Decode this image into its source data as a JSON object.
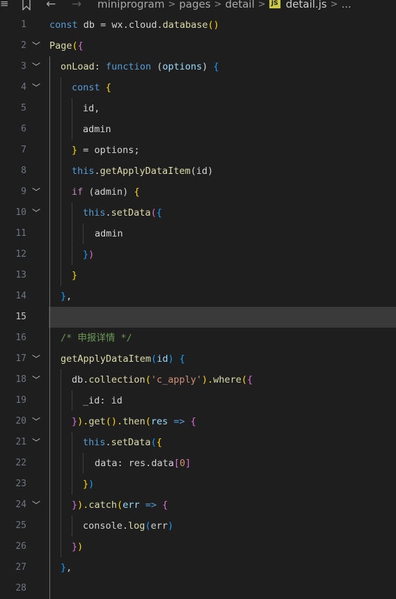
{
  "breadcrumb": {
    "hamburger": "≡",
    "segments": [
      "miniprogram",
      "pages",
      "detail"
    ],
    "file_badge": "JS",
    "file": "detail.js",
    "more": "..."
  },
  "editor": {
    "current_line": 15,
    "lines": [
      {
        "n": "1"
      },
      {
        "n": "2"
      },
      {
        "n": "3"
      },
      {
        "n": "4"
      },
      {
        "n": "5"
      },
      {
        "n": "6"
      },
      {
        "n": "7"
      },
      {
        "n": "8"
      },
      {
        "n": "9"
      },
      {
        "n": "10"
      },
      {
        "n": "11"
      },
      {
        "n": "12"
      },
      {
        "n": "13"
      },
      {
        "n": "14"
      },
      {
        "n": "15"
      },
      {
        "n": "16"
      },
      {
        "n": "17"
      },
      {
        "n": "18"
      },
      {
        "n": "19"
      },
      {
        "n": "20"
      },
      {
        "n": "21"
      },
      {
        "n": "22"
      },
      {
        "n": "23"
      },
      {
        "n": "24"
      },
      {
        "n": "25"
      },
      {
        "n": "26"
      },
      {
        "n": "27"
      },
      {
        "n": "28"
      }
    ],
    "code": {
      "l1": [
        "const",
        " db = ",
        "wx",
        ".",
        "cloud",
        ".",
        "database",
        "()"
      ],
      "l2": [
        "Page",
        "(",
        "{"
      ],
      "l3": [
        "onLoad",
        ": ",
        "function",
        " (",
        "options",
        ") ",
        "{"
      ],
      "l4": [
        "const",
        " ",
        "{"
      ],
      "l5": [
        "id",
        ","
      ],
      "l6": [
        "admin"
      ],
      "l7": [
        "}",
        " = ",
        "options",
        ";"
      ],
      "l8": [
        "this",
        ".",
        "getApplyDataItem",
        "(",
        "id",
        ")"
      ],
      "l9": [
        "if",
        " (",
        "admin",
        ") ",
        "{"
      ],
      "l10": [
        "this",
        ".",
        "setData",
        "(",
        "{"
      ],
      "l11": [
        "admin"
      ],
      "l12": [
        "}",
        ")"
      ],
      "l13": [
        "}"
      ],
      "l14": [
        "}",
        ","
      ],
      "l16": [
        "/* 申报详情 */"
      ],
      "l17": [
        "getApplyDataItem",
        "(",
        "id",
        ") ",
        "{"
      ],
      "l18": [
        "db",
        ".",
        "collection",
        "(",
        "'c_apply'",
        ").",
        "where",
        "(",
        "{"
      ],
      "l19": [
        "_id",
        ": ",
        "id"
      ],
      "l20": [
        "}",
        ").",
        "get",
        "().",
        "then",
        "(",
        "res",
        " => ",
        "{"
      ],
      "l21": [
        "this",
        ".",
        "setData",
        "(",
        "{"
      ],
      "l22": [
        "data",
        ": ",
        "res",
        ".",
        "data",
        "[",
        "0",
        "]"
      ],
      "l23": [
        "}",
        ")"
      ],
      "l24": [
        "}",
        ").",
        "catch",
        "(",
        "err",
        " => ",
        "{"
      ],
      "l25": [
        "console",
        ".",
        "log",
        "(",
        "err",
        ")"
      ],
      "l26": [
        "}",
        ")"
      ],
      "l27": [
        "}",
        ","
      ]
    }
  },
  "colors": {
    "background": "#1e1e1e",
    "current_line": "#3a3a3a",
    "keyword": "#569cd6",
    "function": "#dcdcaa",
    "variable": "#9cdcfe",
    "string": "#ce9178",
    "number": "#b5cea8",
    "comment": "#6a9955",
    "bracket_gold": "#ffd700",
    "bracket_purple": "#da70d6",
    "bracket_blue": "#179fff"
  },
  "icons": {
    "menu": "hamburger-icon",
    "bookmark": "bookmark-icon",
    "back": "arrow-left-icon",
    "forward": "arrow-right-icon",
    "chevron": "chevron-right-icon",
    "fold": "chevron-down-icon"
  }
}
